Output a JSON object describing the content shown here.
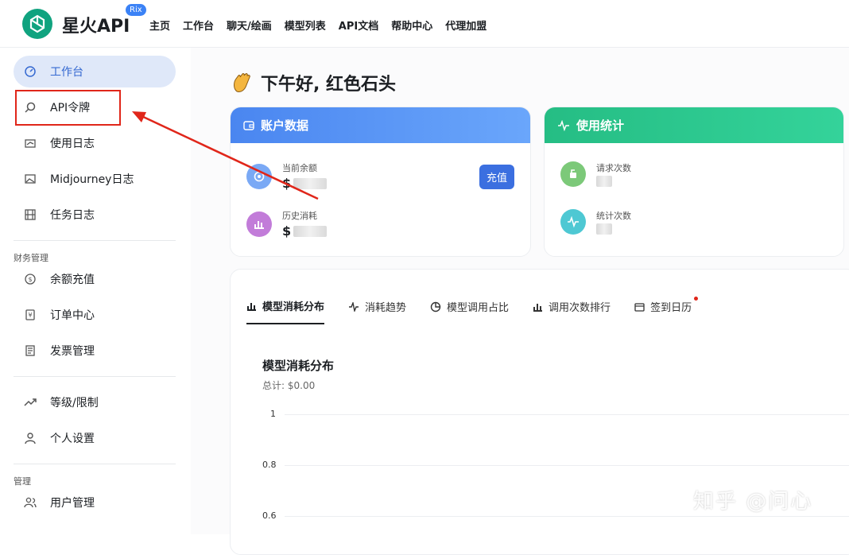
{
  "brand": {
    "name": "星火API",
    "badge": "Rix"
  },
  "nav": [
    "主页",
    "工作台",
    "聊天/绘画",
    "模型列表",
    "API文档",
    "帮助中心",
    "代理加盟"
  ],
  "sidebar": {
    "items": [
      {
        "label": "工作台",
        "icon": "dashboard-icon"
      },
      {
        "label": "API令牌",
        "icon": "search-icon"
      },
      {
        "label": "使用日志",
        "icon": "log-icon"
      },
      {
        "label": "Midjourney日志",
        "icon": "image-icon"
      },
      {
        "label": "任务日志",
        "icon": "film-icon"
      }
    ],
    "finance_group": "财务管理",
    "finance_items": [
      {
        "label": "余额充值",
        "icon": "coin-icon"
      },
      {
        "label": "订单中心",
        "icon": "yuan-icon"
      },
      {
        "label": "发票管理",
        "icon": "invoice-icon"
      }
    ],
    "account_items": [
      {
        "label": "等级/限制",
        "icon": "trend-icon"
      },
      {
        "label": "个人设置",
        "icon": "user-icon"
      }
    ],
    "admin_group": "管理",
    "admin_items": [
      {
        "label": "用户管理",
        "icon": "users-icon"
      }
    ]
  },
  "greeting": "下午好, 红色石头",
  "account_card": {
    "title": "账户数据",
    "balance_label": "当前余额",
    "balance_prefix": "$",
    "history_label": "历史消耗",
    "history_prefix": "$",
    "recharge": "充值",
    "accent": "#4f8ef7"
  },
  "usage_card": {
    "title": "使用统计",
    "requests_label": "请求次数",
    "stats_label": "统计次数",
    "accent": "#2bc48a"
  },
  "tabs": [
    "模型消耗分布",
    "消耗趋势",
    "模型调用占比",
    "调用次数排行",
    "签到日历"
  ],
  "chart_data": {
    "type": "bar",
    "title": "模型消耗分布",
    "subtitle": "总计: $0.00",
    "ylim": [
      0.6,
      1
    ],
    "yticks": [
      "1",
      "0.8",
      "0.6"
    ],
    "series": []
  },
  "watermark": "知乎 @问心"
}
